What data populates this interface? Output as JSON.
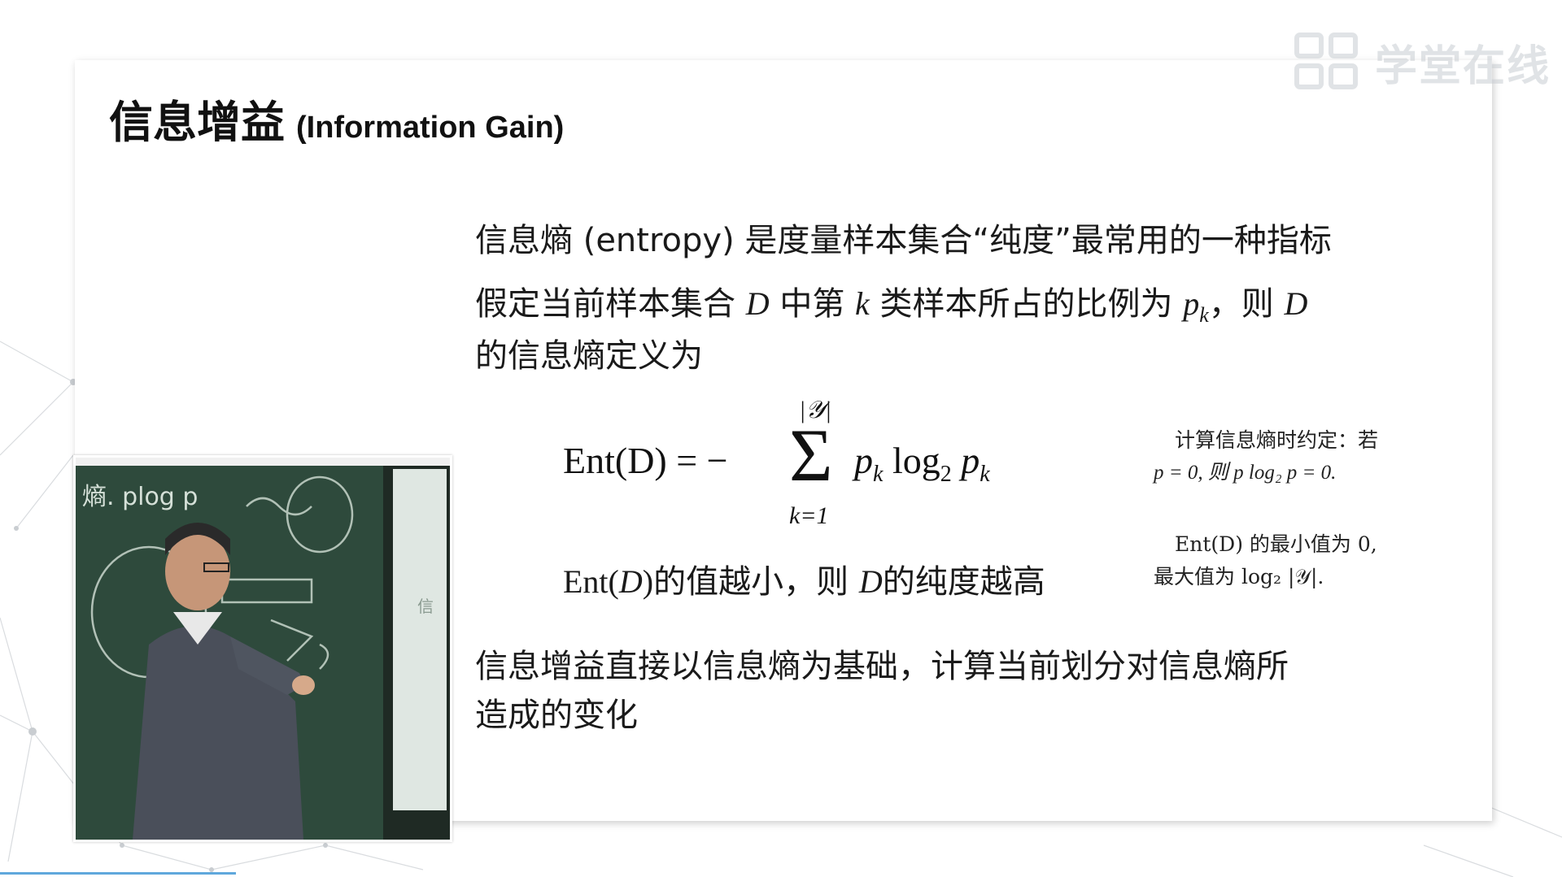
{
  "watermark": {
    "text": "学堂在线"
  },
  "slide": {
    "title_cn": "信息增益",
    "title_en": "(Information Gain)",
    "line1": "信息熵 (entropy) 是度量样本集合“纯度”最常用的一种指标",
    "line2_a": "假定当前样本集合 ",
    "line2_D": "D",
    "line2_b": " 中第 ",
    "line2_k": "k",
    "line2_c": " 类样本所占的比例为 ",
    "line2_pk": "p",
    "line2_pk_sub": "k",
    "line2_d": "，则 ",
    "line2_D2": "D",
    "line3": "的信息熵定义为",
    "formula": {
      "lhs": "Ent(D) = −",
      "sum_upper": "|𝒴|",
      "sum_lower": "k=1",
      "rhs_p": "p",
      "rhs_k": "k",
      "rhs_log": " log",
      "rhs_2": "2",
      "rhs_p2": " p",
      "rhs_k2": "k"
    },
    "smaller_a": "Ent(",
    "smaller_D": "D",
    "smaller_b": ")",
    "smaller_c": "的值越小，则 ",
    "smaller_D2": "D",
    "smaller_d": "的纯度越高",
    "note1_line1": "计算信息熵时约定：若",
    "note1_line2": "p = 0, 则 p log₂ p = 0.",
    "note2_line1": "Ent(D) 的最小值为 0,",
    "note2_line2": "最大值为 log₂ |𝒴|.",
    "para4_line1": "信息增益直接以信息熵为基础，计算当前划分对信息熵所",
    "para4_line2": "造成的变化"
  },
  "video": {
    "blackboard_text": "熵. plog p",
    "side_text": "信"
  },
  "colors": {
    "slide_bg": "#ffffff",
    "blackboard": "#2e4a3c",
    "jacket": "#4a4f5a",
    "progress": "#5fa8dc"
  },
  "icons": {
    "watermark_logo": "xuetangx-logo-icon"
  }
}
